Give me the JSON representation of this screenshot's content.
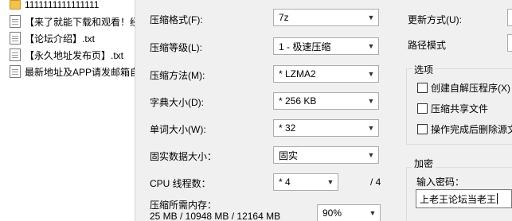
{
  "file_list": {
    "items": [
      {
        "name": "1111111111111111",
        "icon": "folder-icon"
      },
      {
        "name": "【来了就能下载和观看！经",
        "icon": "document-icon"
      },
      {
        "name": "【论坛介绍】.txt",
        "icon": "document-icon"
      },
      {
        "name": "【永久地址发布页】.txt",
        "icon": "document-icon"
      },
      {
        "name": "最新地址及APP请发邮箱自",
        "icon": "document-icon"
      }
    ]
  },
  "form": {
    "archive_format": {
      "label": "压缩格式(F):",
      "value": "7z"
    },
    "compression_level": {
      "label": "压缩等级(L):",
      "value": "1 - 极速压缩"
    },
    "compression_method": {
      "label": "压缩方法(M):",
      "value": "* LZMA2"
    },
    "dictionary_size": {
      "label": "字典大小(D):",
      "value": "* 256 KB"
    },
    "word_size": {
      "label": "单词大小(W):",
      "value": "* 32"
    },
    "solid_block_size": {
      "label": "固实数据大小：",
      "value": "固实"
    },
    "cpu_threads": {
      "label": "CPU 线程数：",
      "value": "* 4",
      "max": "/ 4"
    },
    "memory": {
      "label": "压缩所需内存：",
      "detail": "25 MB / 10948 MB / 12164 MB",
      "percent": "90%"
    }
  },
  "right": {
    "update_mode_label": "更新方式(U):",
    "path_mode_label": "路径模式",
    "options": {
      "title": "选项",
      "items": [
        "创建自解压程序(X)",
        "压缩共享文件",
        "操作完成后删除源文"
      ]
    },
    "encryption": {
      "title": "加密",
      "password_label": "输入密码：",
      "password_value": "上老王论坛当老王"
    }
  },
  "colors": {
    "panel_bg": "#f0f0f0",
    "list_bg": "#ffffff",
    "folder": "#f2c14e"
  }
}
